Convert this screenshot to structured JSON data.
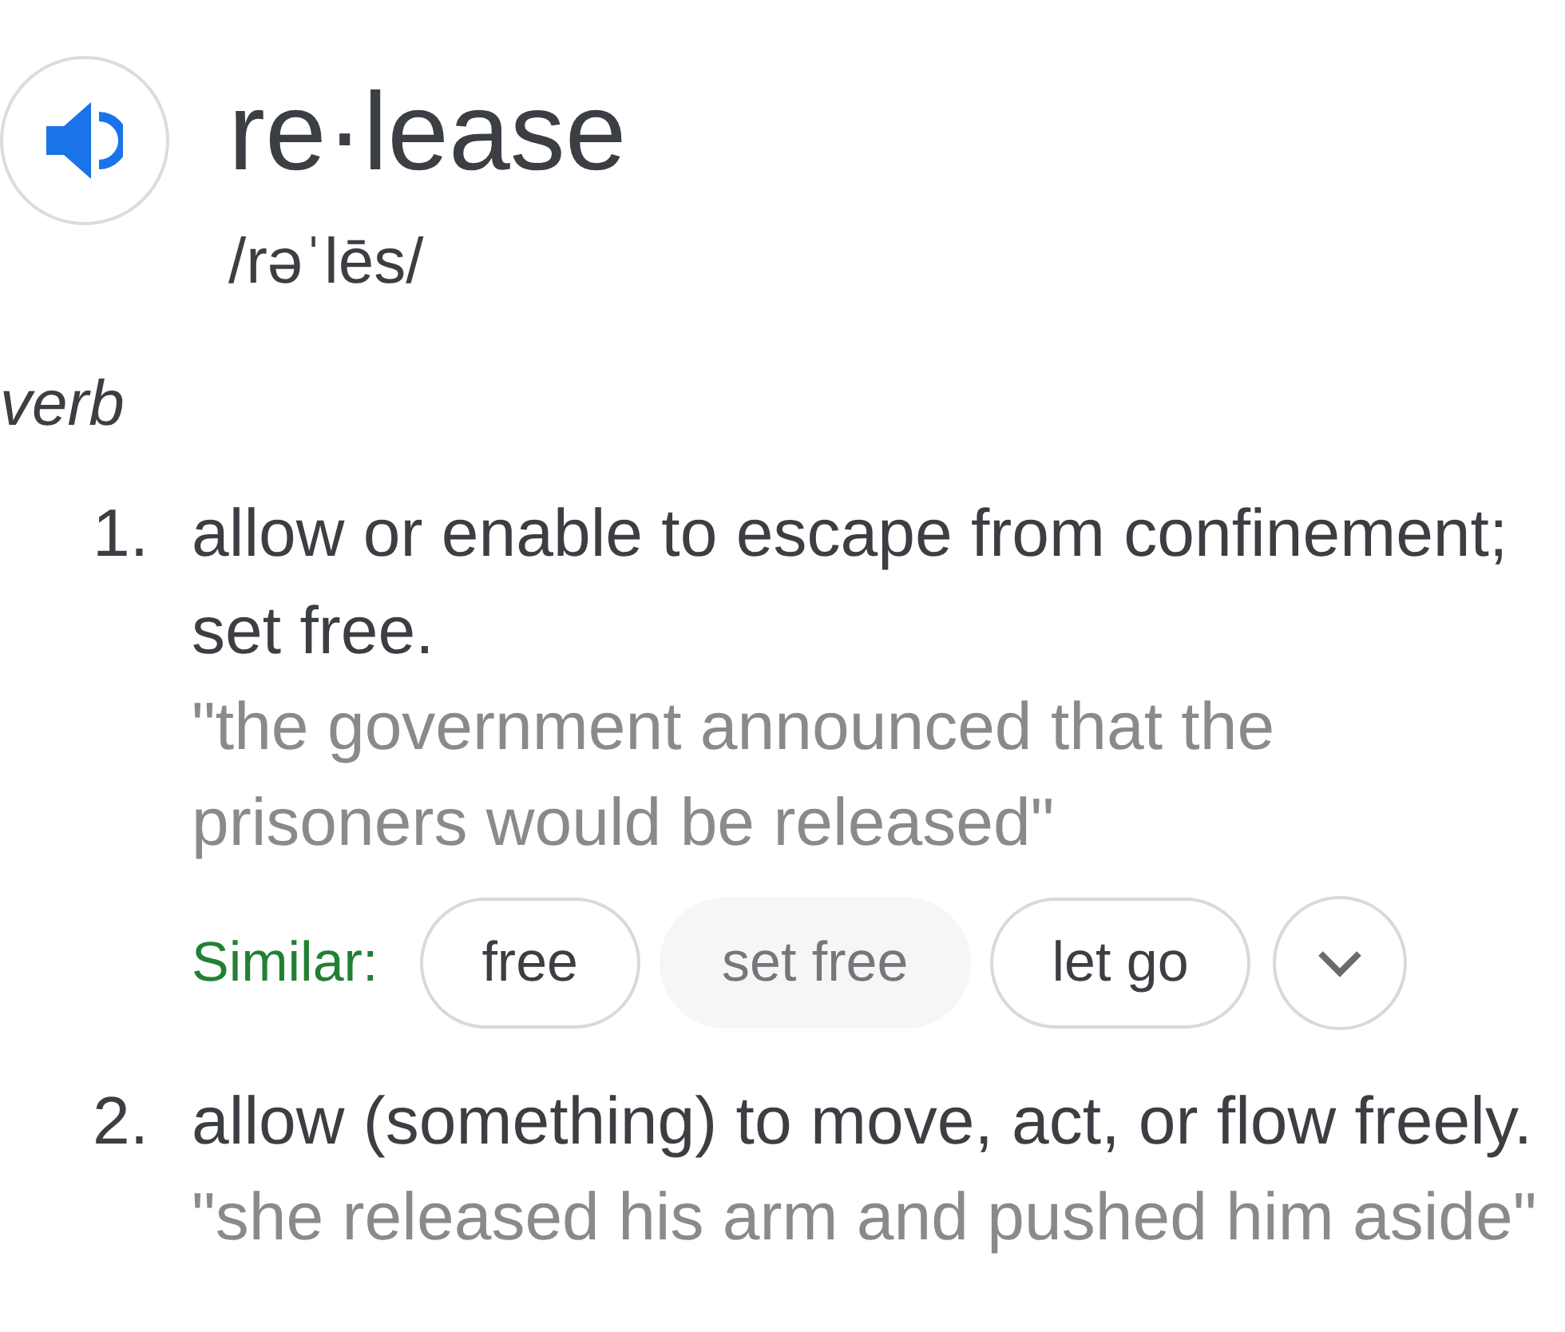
{
  "headword": "re·lease",
  "phonetic": "/rəˈlēs/",
  "part_of_speech": "verb",
  "senses": [
    {
      "number": "1.",
      "definition": "allow or enable to escape from confinement; set free.",
      "example": "\"the government announced that the prisoners would be released\"",
      "similar": {
        "label": "Similar:",
        "words": [
          {
            "text": "free",
            "kind": "link"
          },
          {
            "text": "set free",
            "kind": "plain"
          },
          {
            "text": "let go",
            "kind": "link"
          }
        ]
      }
    },
    {
      "number": "2.",
      "definition": "allow (something) to move, act, or flow freely.",
      "example": "\"she released his arm and pushed him aside\""
    }
  ]
}
